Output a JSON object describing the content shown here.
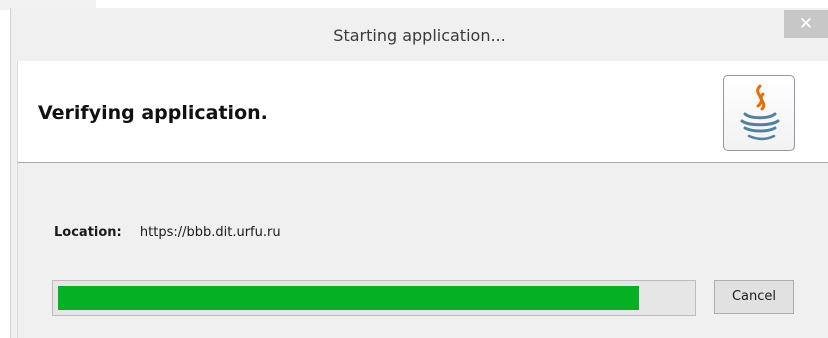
{
  "window": {
    "title": "Starting application...",
    "close_glyph": "✕"
  },
  "header": {
    "title": "Verifying application.",
    "logo_icon": "java-icon"
  },
  "location": {
    "label": "Location:",
    "value": "https://bbb.dit.urfu.ru"
  },
  "progress": {
    "fraction": 0.92,
    "color": "#06b025"
  },
  "buttons": {
    "cancel_label": "Cancel"
  }
}
